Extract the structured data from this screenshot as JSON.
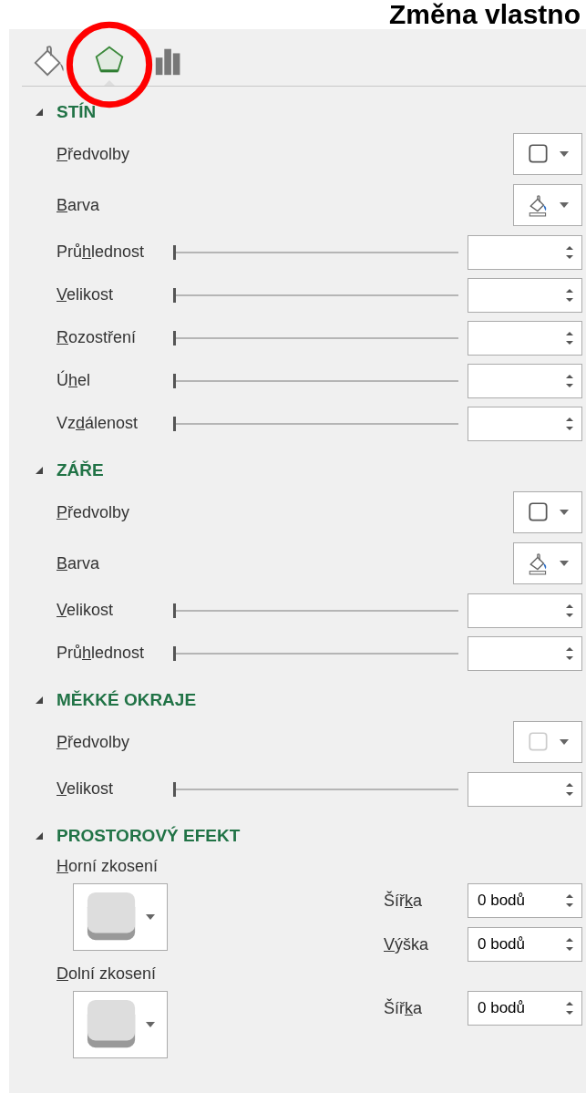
{
  "title": "Změna vlastno",
  "tabs": [
    {
      "kind": "fill",
      "selected": false,
      "circled": false
    },
    {
      "kind": "effects",
      "selected": true,
      "circled": true
    },
    {
      "kind": "size",
      "selected": false,
      "circled": false
    }
  ],
  "sections": [
    {
      "title": "STÍN",
      "expanded": true,
      "rows": [
        {
          "kind": "preset",
          "label": {
            "key": "P",
            "after": "ředvolby"
          },
          "soft": false
        },
        {
          "kind": "color",
          "label": {
            "key": "B",
            "after": "arva"
          }
        },
        {
          "kind": "slider",
          "label": {
            "before": "Prů",
            "key": "h",
            "after": "lednost"
          },
          "level": 0
        },
        {
          "kind": "slider",
          "label": {
            "key": "V",
            "after": "elikost"
          },
          "level": 0
        },
        {
          "kind": "slider",
          "label": {
            "key": "R",
            "after": "ozostření"
          },
          "level": 0
        },
        {
          "kind": "slider",
          "label": {
            "before": "Ú",
            "key": "h",
            "after": "el"
          },
          "level": 0
        },
        {
          "kind": "slider",
          "label": {
            "before": "Vz",
            "key": "d",
            "after": "álenost"
          },
          "level": 0
        }
      ]
    },
    {
      "title": "ZÁŘE",
      "expanded": true,
      "rows": [
        {
          "kind": "preset",
          "label": {
            "key": "P",
            "after": "ředvolby"
          },
          "soft": false
        },
        {
          "kind": "color",
          "label": {
            "key": "B",
            "after": "arva"
          }
        },
        {
          "kind": "slider",
          "label": {
            "key": "V",
            "after": "elikost"
          },
          "level": 0
        },
        {
          "kind": "slider",
          "label": {
            "before": "Prů",
            "key": "h",
            "after": "lednost"
          },
          "level": 0
        }
      ]
    },
    {
      "title": "MĚKKÉ OKRAJE",
      "expanded": true,
      "rows": [
        {
          "kind": "preset",
          "label": {
            "key": "P",
            "after": "ředvolby"
          },
          "soft": true
        },
        {
          "kind": "slider",
          "label": {
            "key": "V",
            "after": "elikost"
          },
          "level": 0
        }
      ]
    },
    {
      "title": "PROSTOROVÝ EFEKT",
      "expanded": true,
      "rows": [
        {
          "kind": "bevel",
          "label": {
            "key": "H",
            "after": "orní zkosení"
          },
          "fields": [
            {
              "label": {
                "before": "Šíř",
                "key": "k",
                "after": "a"
              },
              "value": "0 bodů"
            },
            {
              "label": {
                "key": "V",
                "after": "ýška"
              },
              "value": "0 bodů"
            }
          ]
        },
        {
          "kind": "bevel",
          "label": {
            "key": "D",
            "after": "olní zkosení"
          },
          "fields": [
            {
              "label": {
                "before": "Šíř",
                "key": "k",
                "after": "a"
              },
              "value": "0 bodů"
            }
          ]
        }
      ]
    }
  ]
}
